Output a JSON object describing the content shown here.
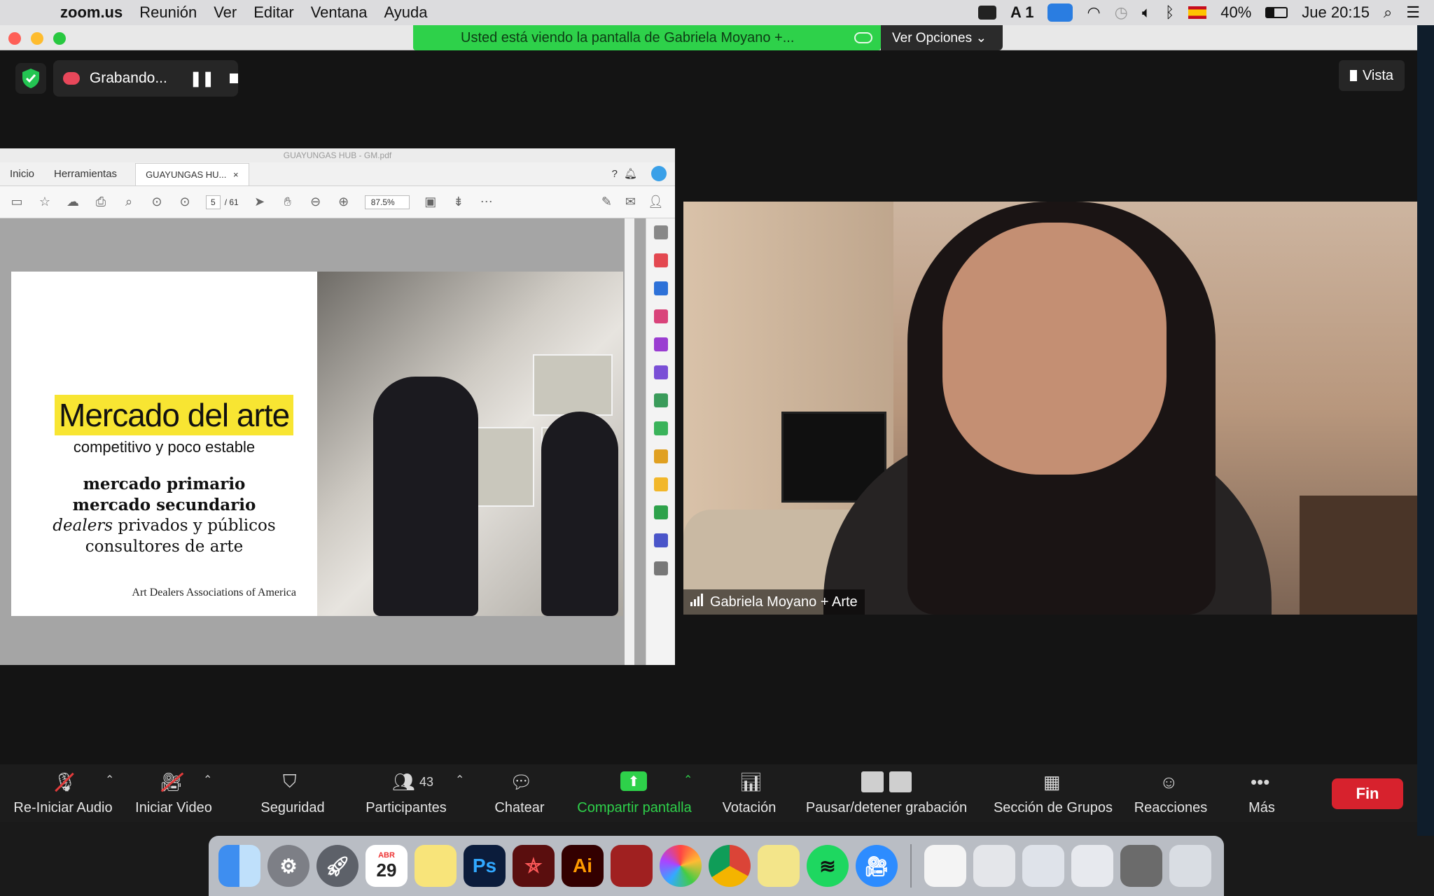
{
  "menubar": {
    "app": "zoom.us",
    "items": [
      "Reunión",
      "Ver",
      "Editar",
      "Ventana",
      "Ayuda"
    ],
    "right": {
      "adobe_count": "1",
      "battery": "40%",
      "clock": "Jue 20:15"
    }
  },
  "banner": {
    "text": "Usted está viendo la pantalla de Gabriela Moyano +...",
    "options": "Ver Opciones ⌄"
  },
  "top": {
    "recording": "Grabando...",
    "vista": "Vista"
  },
  "acrobat": {
    "window_title": "GUAYUNGAS HUB - GM.pdf",
    "tabs": [
      "Inicio",
      "Herramientas"
    ],
    "active_tab": "GUAYUNGAS HU...",
    "close": "×",
    "page_current": "5",
    "page_total": "/ 61",
    "zoom": "87.5%"
  },
  "slide": {
    "title": "Mercado del arte",
    "subtitle": "competitivo y poco estable",
    "lines": [
      "mercado primario",
      "mercado secundario",
      "privados y públicos",
      "consultores de arte"
    ],
    "italic_word": "dealers",
    "footer": "Art Dealers Associations of America"
  },
  "video": {
    "participant_name": "Gabriela Moyano + Arte"
  },
  "toolbar": {
    "audio": "Re-Iniciar Audio",
    "video": "Iniciar Video",
    "security": "Seguridad",
    "participants": "Participantes",
    "participants_count": "43",
    "chat": "Chatear",
    "share": "Compartir pantalla",
    "poll": "Votación",
    "record": "Pausar/detener grabación",
    "breakout": "Sección de Grupos",
    "reactions": "Reacciones",
    "more": "Más",
    "end": "Fin"
  },
  "dock": {
    "calendar_month": "ABR",
    "calendar_day": "29",
    "ps": "Ps",
    "ai": "Ai"
  },
  "colors": {
    "share_green": "#2ed14a",
    "end_red": "#d7222d",
    "highlight_yellow": "#f8e532"
  }
}
